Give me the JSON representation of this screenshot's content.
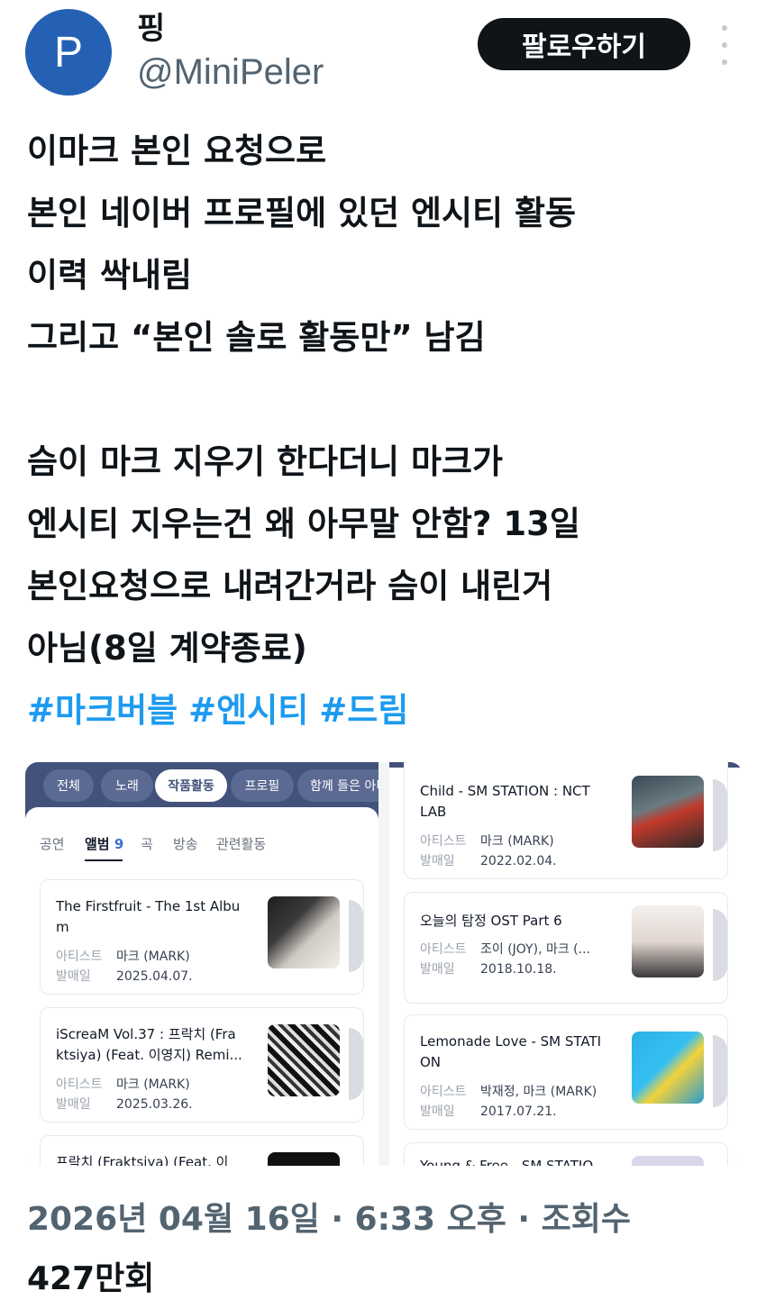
{
  "author": {
    "avatar_letter": "P",
    "avatar_color": "#2461b4",
    "display_name": "핑",
    "handle": "@MiniPeler"
  },
  "follow_label": "팔로우하기",
  "tweet": {
    "lines": [
      "이마크 본인 요청으로",
      "본인 네이버 프로필에 있던 엔시티 활동",
      "이력 싹내림",
      "그리고 “본인 솔로 활동만” 남김",
      "",
      "슴이 마크 지우기 한다더니 마크가",
      "엔시티 지우는건 왜 아무말 안함? 13일",
      "본인요청으로 내려간거라 슴이 내린거",
      "아님(8일 계약종료)"
    ],
    "hashtags": [
      "#마크버블",
      "#엔시티",
      "#드림"
    ],
    "hashtag_color": "#1d9bf0"
  },
  "media": {
    "left_panel": {
      "nav_tabs": [
        "전체",
        "노래",
        "작품활동",
        "프로필",
        "함께 들은 아티"
      ],
      "active_tab": "작품활동",
      "sub_tabs": {
        "performance": "공연",
        "album": "앨범",
        "album_count": "9",
        "song": "곡",
        "broadcast": "방송",
        "related": "관련활동"
      },
      "albums": [
        {
          "title_lines": [
            "The Firstfruit - The 1st Albu",
            "m"
          ],
          "artist_label": "아티스트",
          "artist": "마크 (MARK)",
          "date_label": "발매일",
          "date": "2025.04.07."
        },
        {
          "title_lines": [
            "iScreaM Vol.37 : 프락치 (Fra",
            "ktsiya) (Feat. 이영지) Remi..."
          ],
          "artist_label": "아티스트",
          "artist": "마크 (MARK)",
          "date_label": "발매일",
          "date": "2025.03.26."
        },
        {
          "title_lines": [
            "프락치 (Fraktsiya) (Feat. 이"
          ]
        }
      ]
    },
    "right_panel": {
      "albums": [
        {
          "title_lines": [
            "Child - SM STATION : NCT",
            "LAB"
          ],
          "artist_label": "아티스트",
          "artist": "마크 (MARK)",
          "date_label": "발매일",
          "date": "2022.02.04."
        },
        {
          "title_lines": [
            "오늘의 탐정 OST Part 6"
          ],
          "artist_label": "아티스트",
          "artist": "조이 (JOY), 마크 (...",
          "date_label": "발매일",
          "date": "2018.10.18."
        },
        {
          "title_lines": [
            "Lemonade Love - SM STATI",
            "ON"
          ],
          "artist_label": "아티스트",
          "artist": "박재정, 마크 (MARK)",
          "date_label": "발매일",
          "date": "2017.07.21."
        },
        {
          "title_lines": [
            "Young & Free - SM STATIO"
          ]
        }
      ]
    }
  },
  "footer": {
    "timestamp": "2026년 04월 16일 · 6:33 오후 · 조회수",
    "views": "427만",
    "views_label": "회"
  }
}
